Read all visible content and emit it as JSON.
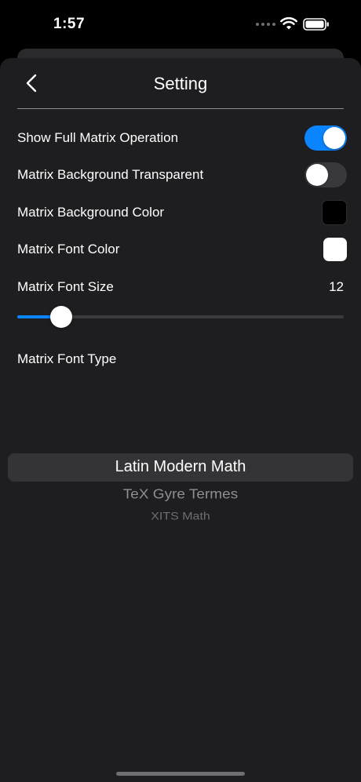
{
  "status_bar": {
    "time": "1:57",
    "icons": [
      "wifi-icon",
      "battery-icon"
    ]
  },
  "nav": {
    "title": "Setting",
    "back_icon": "chevron-left-icon"
  },
  "settings": {
    "show_full_matrix_operation": {
      "label": "Show Full Matrix Operation",
      "enabled": true
    },
    "matrix_background_transparent": {
      "label": "Matrix Background Transparent",
      "enabled": false
    },
    "matrix_background_color": {
      "label": "Matrix Background Color",
      "color": "#000000"
    },
    "matrix_font_color": {
      "label": "Matrix Font Color",
      "color": "#ffffff"
    },
    "matrix_font_size": {
      "label": "Matrix Font Size",
      "value": "12",
      "slider_fraction": 0.135
    },
    "matrix_font_type": {
      "label": "Matrix Font Type",
      "options": [
        "Latin Modern Math",
        "TeX Gyre Termes",
        "XITS Math"
      ],
      "selected": "Latin Modern Math"
    }
  },
  "colors": {
    "accent": "#0a84ff",
    "sheet_background": "#1e1e20",
    "toggle_off": "#39393d"
  }
}
